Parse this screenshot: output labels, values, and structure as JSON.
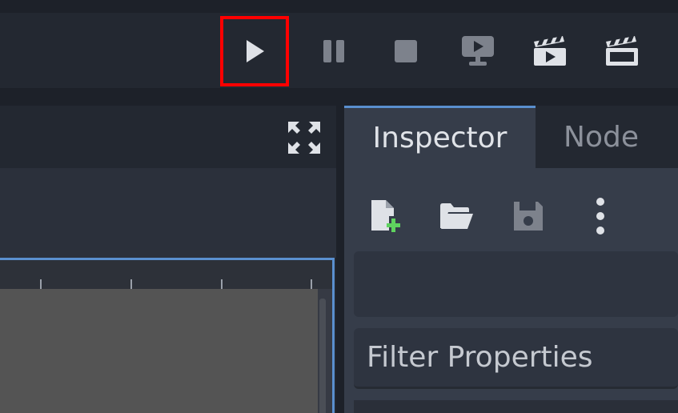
{
  "playbar": {
    "buttons": [
      {
        "name": "play-button",
        "icon": "play-icon",
        "highlighted": true
      },
      {
        "name": "pause-button",
        "icon": "pause-icon"
      },
      {
        "name": "stop-button",
        "icon": "stop-icon"
      },
      {
        "name": "remote-debug-button",
        "icon": "remote-deploy-icon"
      },
      {
        "name": "play-scene-button",
        "icon": "clapperboard-play-icon"
      },
      {
        "name": "play-custom-scene-button",
        "icon": "clapperboard-icon"
      }
    ],
    "highlight_color": "#ff0000"
  },
  "viewport": {
    "expand_icon": "distraction-free-expand-icon",
    "accent": "#5a8fcf"
  },
  "inspector": {
    "tabs": [
      {
        "label": "Inspector",
        "active": true
      },
      {
        "label": "Node",
        "active": false
      }
    ],
    "toolbar": [
      {
        "name": "new-resource-button",
        "icon": "new-file-icon"
      },
      {
        "name": "load-resource-button",
        "icon": "folder-open-icon"
      },
      {
        "name": "save-resource-button",
        "icon": "save-icon"
      },
      {
        "name": "more-options-button",
        "icon": "vertical-ellipsis-icon"
      }
    ],
    "filter": {
      "placeholder": "Filter Properties"
    }
  }
}
